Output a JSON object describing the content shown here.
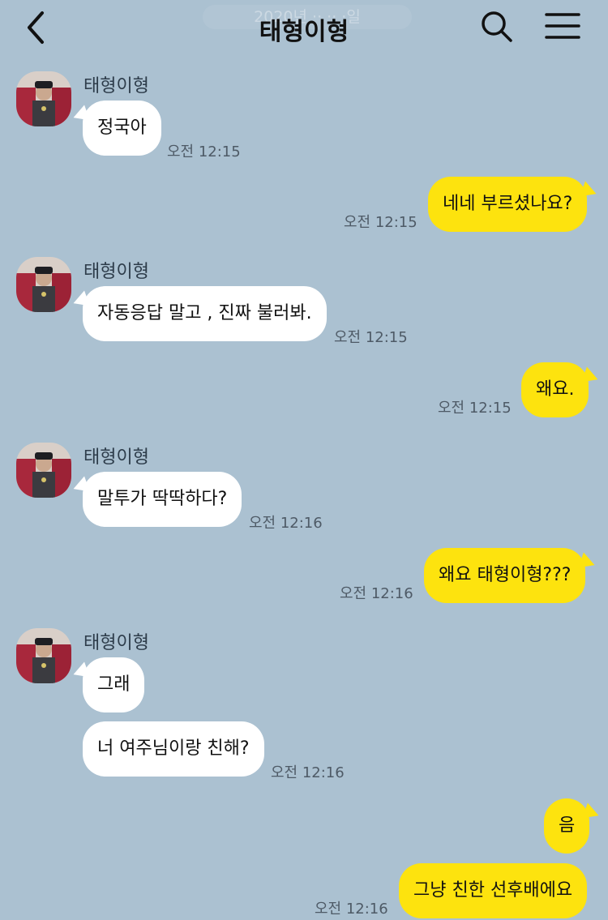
{
  "header": {
    "title": "태형이형",
    "date_overlay": "2020년 ·· ·· ·일"
  },
  "messages": [
    {
      "sender": "태형이형",
      "text": "정국아",
      "time": "오전 12:15"
    },
    {
      "text": "네네 부르셨나요?",
      "time": "오전 12:15"
    },
    {
      "sender": "태형이형",
      "text": "자동응답 말고 , 진짜 불러봐.",
      "time": "오전 12:15"
    },
    {
      "text": "왜요.",
      "time": "오전 12:15"
    },
    {
      "sender": "태형이형",
      "text": "말투가 딱딱하다?",
      "time": "오전 12:16"
    },
    {
      "text": "왜요 태형이형???",
      "time": "오전 12:16"
    },
    {
      "sender": "태형이형",
      "text": "그래",
      "time": ""
    },
    {
      "text": "너 여주님이랑 친해?",
      "time": "오전 12:16"
    },
    {
      "text": "음",
      "time": ""
    },
    {
      "text": "그냥 친한 선후배에요",
      "time": "오전 12:16"
    }
  ],
  "colors": {
    "background": "#abc1d1",
    "incoming_bubble": "#ffffff",
    "outgoing_bubble": "#fde30e"
  },
  "icons": [
    "back-arrow-icon",
    "search-icon",
    "menu-icon"
  ]
}
